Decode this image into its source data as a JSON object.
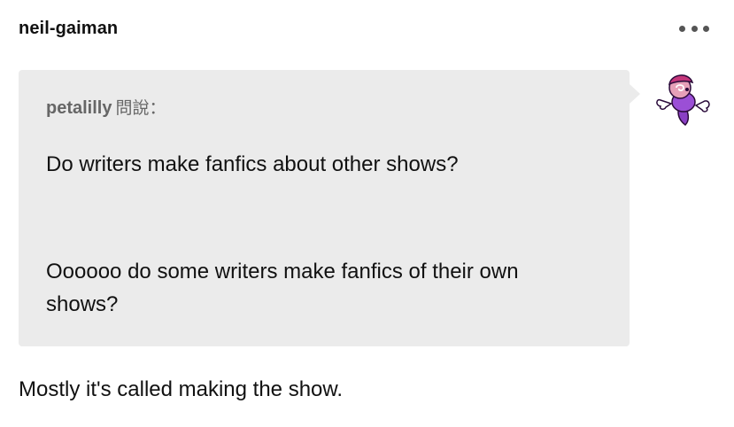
{
  "post": {
    "blog_name": "neil-gaiman",
    "more_icon": "ellipsis-icon"
  },
  "ask": {
    "asker_name": "petalilly",
    "asker_suffix": "問說：",
    "question_paragraph_1": "Do writers make fanfics about other shows?",
    "question_paragraph_2": "Oooooo do some writers make fanfics of their own shows?",
    "box_color": "#ebebeb",
    "avatar_icon": "purple-ghost-avatar-icon"
  },
  "answer": {
    "text": "Mostly it's called making the show."
  }
}
